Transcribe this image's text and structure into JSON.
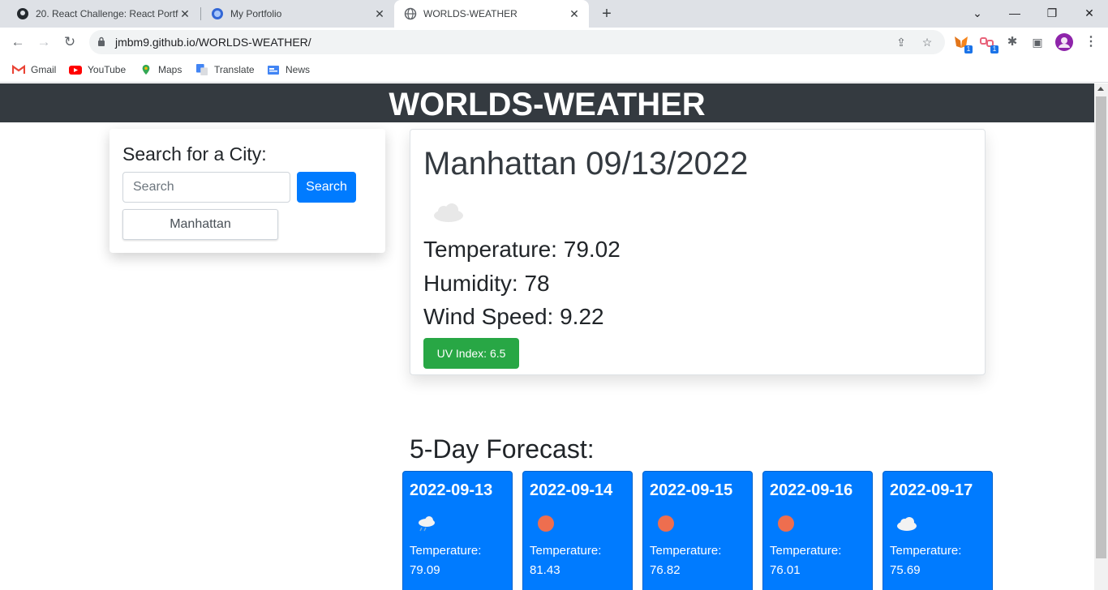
{
  "browser": {
    "tabs": [
      {
        "title": "20. React Challenge: React Portfo",
        "icon": "github-icon"
      },
      {
        "title": "My Portfolio",
        "icon": "globe-icon"
      },
      {
        "title": "WORLDS-WEATHER",
        "icon": "globe-icon"
      }
    ],
    "url": "jmbm9.github.io/WORLDS-WEATHER/",
    "bookmarks": [
      {
        "label": "Gmail",
        "icon": "gmail-icon"
      },
      {
        "label": "YouTube",
        "icon": "youtube-icon"
      },
      {
        "label": "Maps",
        "icon": "maps-icon"
      },
      {
        "label": "Translate",
        "icon": "translate-icon"
      },
      {
        "label": "News",
        "icon": "news-icon"
      }
    ],
    "extension_badges": [
      "1",
      "1"
    ]
  },
  "header": {
    "title": "WORLDS-WEATHER"
  },
  "search": {
    "heading": "Search for a City:",
    "placeholder": "Search",
    "value": "",
    "button_label": "Search",
    "history": [
      "Manhattan"
    ]
  },
  "current": {
    "city_date": "Manhattan 09/13/2022",
    "icon": "cloud-icon",
    "temperature": "Temperature: 79.02",
    "humidity": "Humidity: 78",
    "wind": "Wind Speed: 9.22",
    "uv_label": "UV Index: ",
    "uv_value": "6.5"
  },
  "forecast": {
    "title": "5-Day Forecast:",
    "days": [
      {
        "date": "2022-09-13",
        "icon": "rain-cloud-icon",
        "label": "Temperature:",
        "temp": "79.09"
      },
      {
        "date": "2022-09-14",
        "icon": "sun-icon",
        "label": "Temperature:",
        "temp": "81.43"
      },
      {
        "date": "2022-09-15",
        "icon": "sun-icon",
        "label": "Temperature:",
        "temp": "76.82"
      },
      {
        "date": "2022-09-16",
        "icon": "sun-icon",
        "label": "Temperature:",
        "temp": "76.01"
      },
      {
        "date": "2022-09-17",
        "icon": "cloud-icon",
        "label": "Temperature:",
        "temp": "75.69"
      }
    ]
  },
  "colors": {
    "header_bg": "#343a40",
    "primary": "#007bff",
    "uv_good": "#28a745"
  }
}
